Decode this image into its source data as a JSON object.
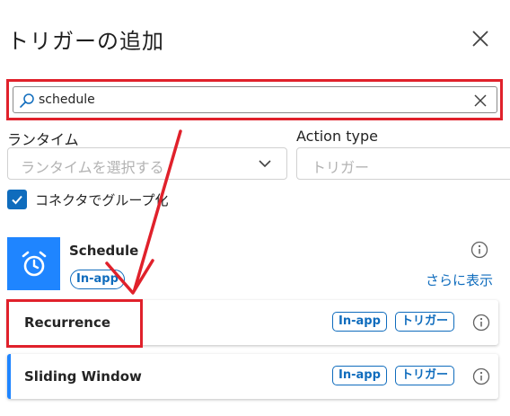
{
  "panel": {
    "title": "トリガーの追加"
  },
  "search": {
    "value": "schedule"
  },
  "filters": {
    "runtime": {
      "label": "ランタイム",
      "placeholder": "ランタイムを選択する"
    },
    "action_type": {
      "label": "Action type",
      "placeholder": "トリガー"
    },
    "group_by_connector": {
      "label": "コネクタでグループ化",
      "checked": true
    }
  },
  "connector": {
    "name": "Schedule",
    "badge": "In-app",
    "more_link": "さらに表示"
  },
  "operations": [
    {
      "name": "Recurrence",
      "badge1": "In-app",
      "badge2": "トリガー"
    },
    {
      "name": "Sliding Window",
      "badge1": "In-app",
      "badge2": "トリガー"
    }
  ],
  "colors": {
    "accent": "#0f6cbd",
    "connector_bg": "#1f85ff",
    "highlight": "#e0212b"
  }
}
